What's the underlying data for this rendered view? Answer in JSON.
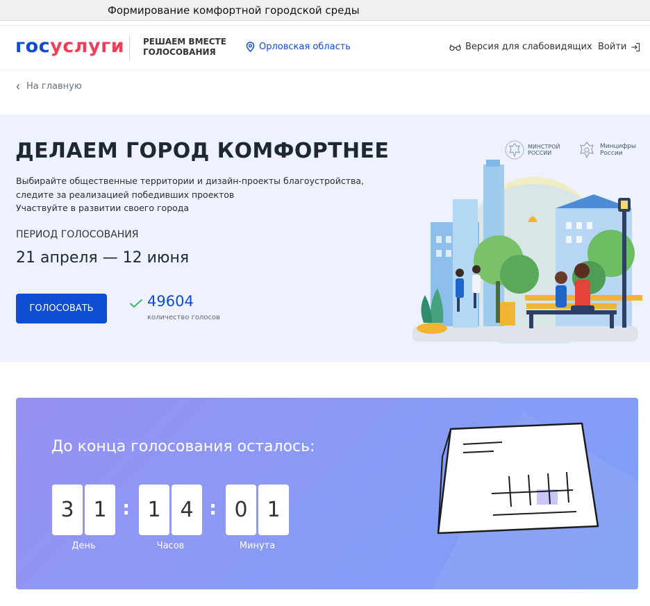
{
  "window": {
    "title": "Формирование комфортной городской среды"
  },
  "header": {
    "logo_part1": "гос",
    "logo_part2": "услуги",
    "project_line1": "РЕШАЕМ ВМЕСТЕ",
    "project_line2": "ГОЛОСОВАНИЯ",
    "region": "Орловская область",
    "vision_mode": "Версия для слабовидящих",
    "login": "Войти"
  },
  "breadcrumb": {
    "label": "На главную"
  },
  "hero": {
    "title": "ДЕЛАЕМ ГОРОД КОМФОРТНЕЕ",
    "description": [
      "Выбирайте общественные территории и дизайн-проекты благоустройства,",
      "следите за реализацией победивших проектов",
      "Участвуйте в развитии своего города"
    ],
    "period_label": "ПЕРИОД ГОЛОСОВАНИЯ",
    "period_dates": "21 апреля — 12 июня",
    "vote_button": "ГОЛОСОВАТЬ",
    "votes_count": "49604",
    "votes_caption": "количество голосов",
    "ministry1": [
      "МИНСТРОЙ",
      "РОССИИ"
    ],
    "ministry2": [
      "Минцифры",
      "России"
    ]
  },
  "countdown": {
    "title": "До конца голосования осталось:",
    "days": [
      "3",
      "1"
    ],
    "hours": [
      "1",
      "4"
    ],
    "minutes": [
      "0",
      "1"
    ],
    "days_label": "День",
    "hours_label": "Часов",
    "minutes_label": "Минута"
  },
  "colors": {
    "brand_blue": "#0d4cd3",
    "brand_red": "#ee3f58",
    "hero_bg": "#edf2fe",
    "countdown_gradient": [
      "#9790f2",
      "#7e9ff6"
    ]
  },
  "icons": [
    "location-pin-icon",
    "glasses-icon",
    "login-arrow-icon",
    "chevron-left-icon",
    "checkmark-icon",
    "eagle-emblem-icon"
  ]
}
